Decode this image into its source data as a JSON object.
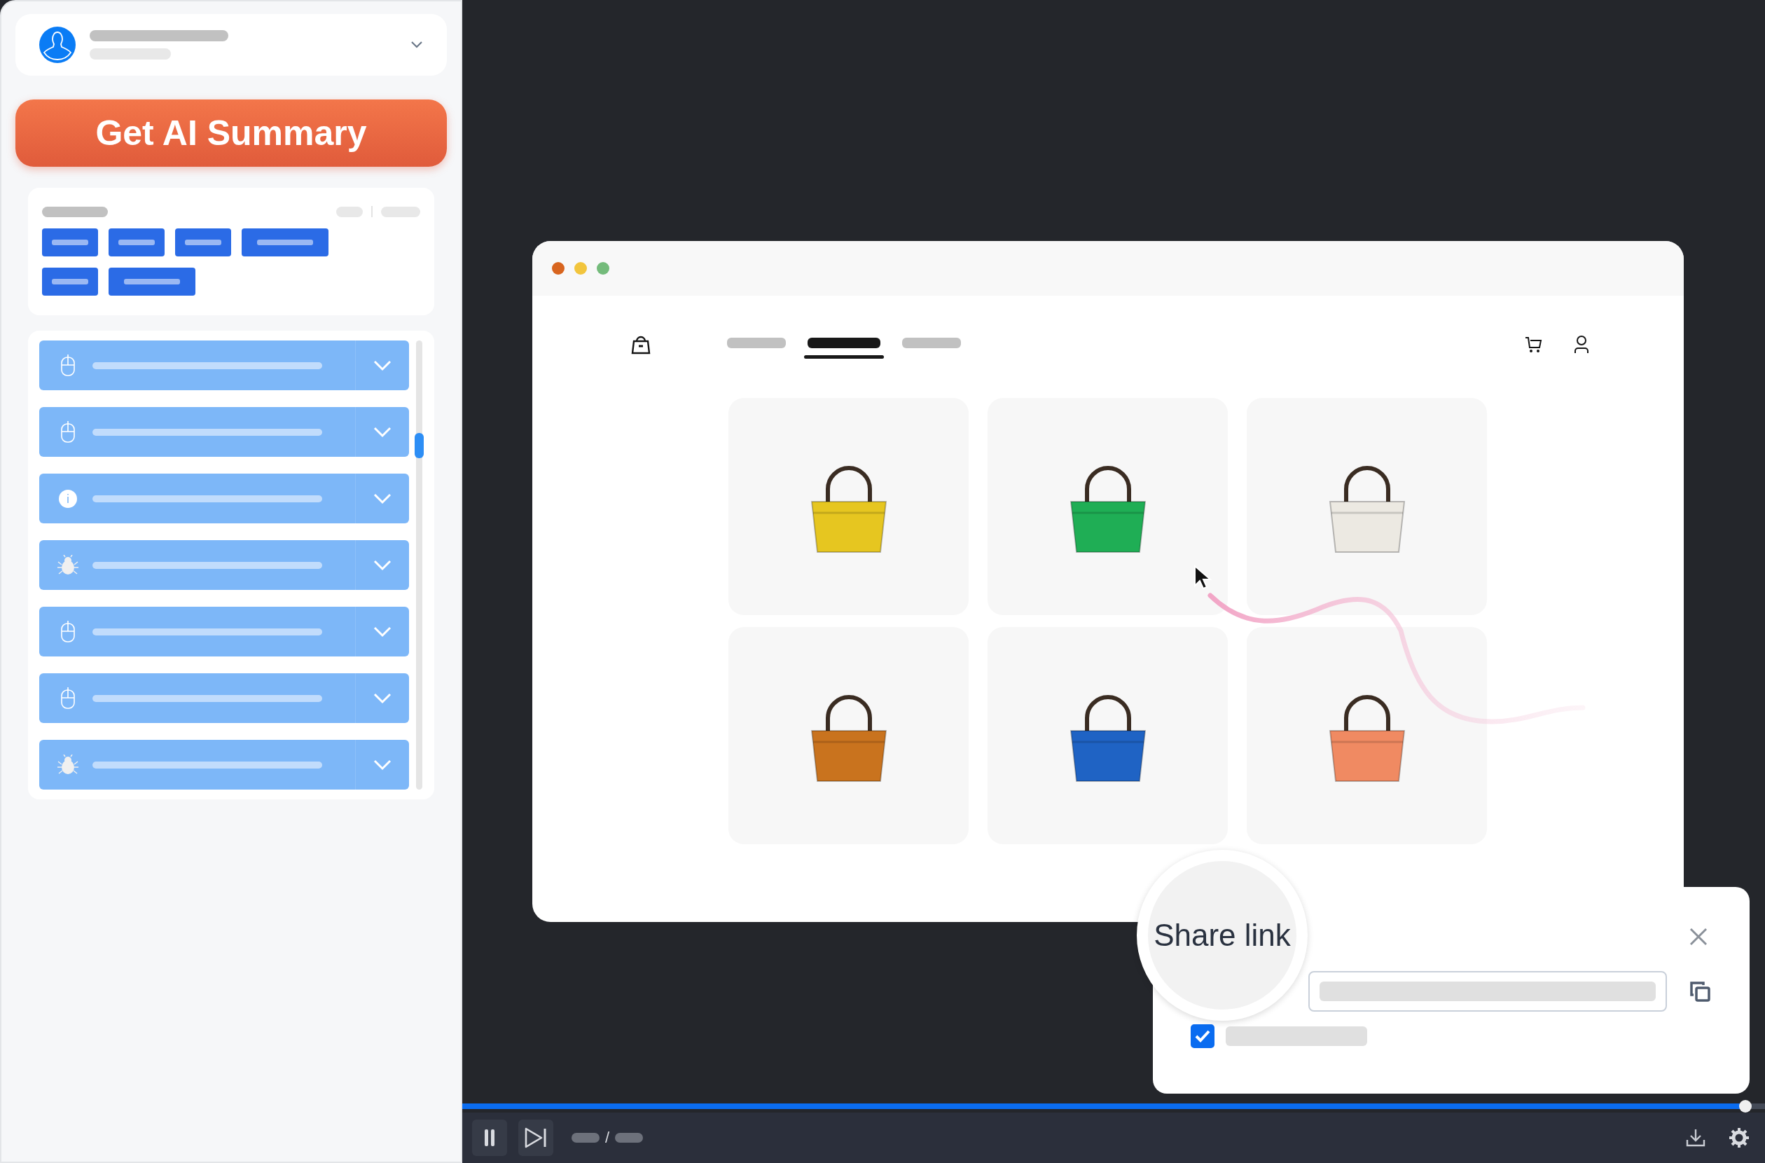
{
  "summary_button": {
    "label": "Get AI Summary"
  },
  "tag_card": {
    "tags": [
      {
        "kind": "short"
      },
      {
        "kind": "short"
      },
      {
        "kind": "short"
      },
      {
        "kind": "long"
      },
      {
        "kind": "short"
      },
      {
        "kind": "long"
      }
    ]
  },
  "event_list": {
    "items": [
      {
        "kind": "mouse",
        "expanded": false
      },
      {
        "kind": "mouse",
        "expanded": false
      },
      {
        "kind": "info",
        "expanded": false
      },
      {
        "kind": "bug",
        "expanded": false
      },
      {
        "kind": "mouse",
        "expanded": false
      },
      {
        "kind": "mouse",
        "expanded": false
      },
      {
        "kind": "bug",
        "expanded": false
      }
    ]
  },
  "browser": {
    "nav_tabs": [
      {
        "selected": false
      },
      {
        "selected": true
      },
      {
        "selected": false
      }
    ],
    "products": [
      {
        "color": "#e6c620"
      },
      {
        "color": "#1fae55"
      },
      {
        "color": "#ece9e2"
      },
      {
        "color": "#c9731e"
      },
      {
        "color": "#1f63c4"
      },
      {
        "color": "#f08a62"
      }
    ]
  },
  "share_dialog": {
    "title": "Share link",
    "checkbox": {
      "checked": true
    }
  },
  "player": {
    "playing": true,
    "time_separator": "/",
    "progress": {
      "level": 0.985
    }
  }
}
